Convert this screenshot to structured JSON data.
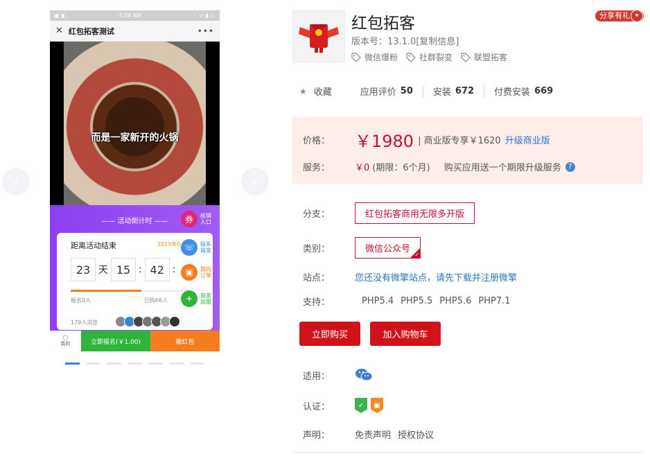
{
  "phone": {
    "status_left": "▣ ◧",
    "status_time": "4:58 AM",
    "status_right": "◦ ᯤ ▮ ▭",
    "title": "红包拓客测试",
    "close_glyph": "✕",
    "more_glyph": "•••",
    "video_caption": "而是一家新开的火锅",
    "countdown_title": "—— 活动倒计时 ——",
    "side_buttons": [
      {
        "label": "核销\n入口",
        "color": "#e1267c"
      },
      {
        "label": "联系\n商家",
        "color": "#3a8fe8"
      },
      {
        "label": "我的\n订单",
        "color": "#f57d20"
      },
      {
        "label": "商家\n加盟",
        "color": "#2fb43a"
      }
    ],
    "card": {
      "end_label": "距离活动结束",
      "date": "2019年0",
      "days": "23",
      "days_unit": "天",
      "hours": "15",
      "minutes": "42",
      "colon": ":",
      "progress": 0.6,
      "stat_left": "报名0人",
      "stat_right": "已购66人",
      "views": "179人浏览"
    },
    "bottom": {
      "me": "我的",
      "signup": "立即报名(￥1.00)",
      "redpack": "撒红包"
    }
  },
  "gallery": {
    "prev_glyph": "‹",
    "next_glyph": "›",
    "dots": 7,
    "active_dot": 0
  },
  "app": {
    "name": "红包拓客",
    "version": "版本号：13.1.0[复制信息]",
    "tags": [
      "微信爆粉",
      "社群裂变",
      "联盟拓客"
    ],
    "share": "分享有礼"
  },
  "stats": {
    "favorite": "收藏",
    "rating_label": "应用评价",
    "rating_value": "50",
    "install_label": "安装",
    "install_value": "672",
    "paid_label": "付费安装",
    "paid_value": "669"
  },
  "price": {
    "label": "价格：",
    "main": "￥1980",
    "sub": "| 商业版专享￥1620",
    "upgrade": "升级商业版",
    "service_label": "服务：",
    "service_price": "￥0",
    "service_period": "(期限：6个月)",
    "service_note": "购买应用送一个期限升级服务",
    "help_glyph": "?"
  },
  "fields": {
    "branch_label": "分支：",
    "branch_value": "红包拓客商用无限多开版",
    "category_label": "类别：",
    "category_value": "微信公众号",
    "site_label": "站点：",
    "site_value": "您还没有微擎站点，请先下载并注册微擎",
    "support_label": "支持：",
    "php": [
      "PHP5.4",
      "PHP5.5",
      "PHP5.6",
      "PHP7.1"
    ],
    "applicable_label": "适用：",
    "cert_label": "认证：",
    "statement_label": "声明：",
    "disclaimer": "免责声明",
    "license": "授权协议"
  },
  "buttons": {
    "buy": "立即购买",
    "cart": "加入购物车"
  },
  "colors": {
    "accent_red": "#d0121b",
    "price_red": "#c8102e",
    "link_blue": "#2f74c0",
    "price_bg": "#fdeee9"
  }
}
